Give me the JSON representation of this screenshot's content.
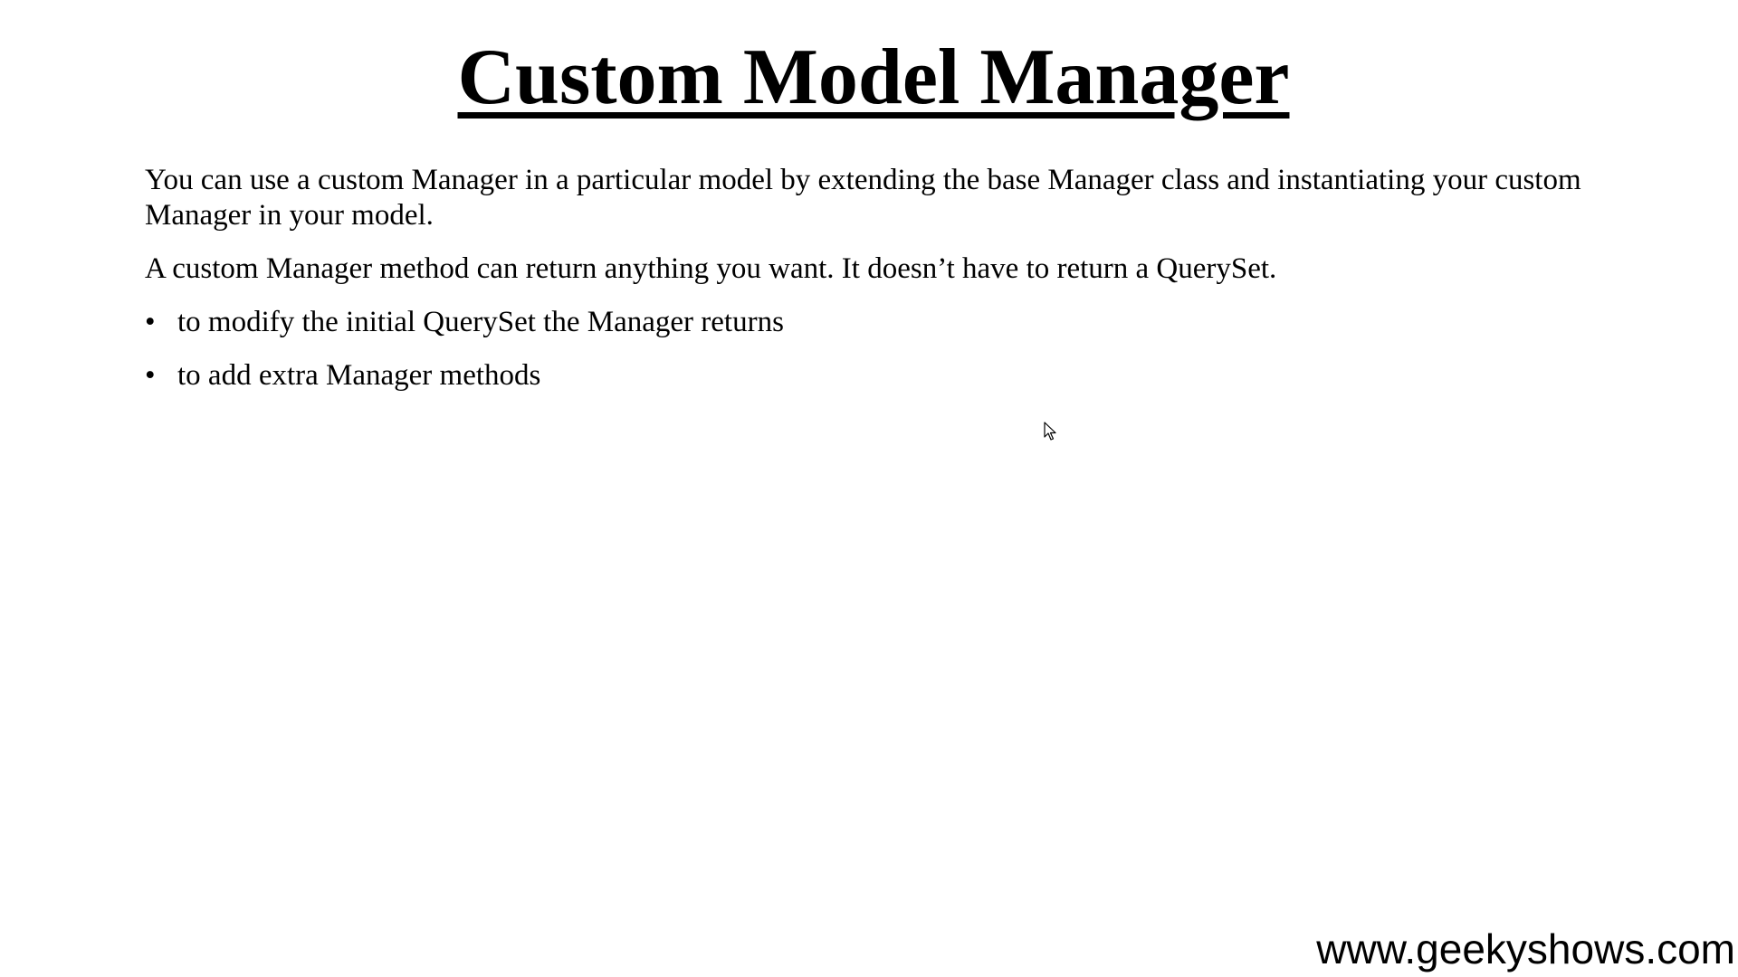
{
  "slide": {
    "title": "Custom Model Manager",
    "paragraphs": [
      "You can use a custom Manager in a particular model by extending the base Manager class and instantiating your custom Manager in your model.",
      "A custom Manager method can return anything you want. It doesn’t have to return a QuerySet."
    ],
    "bullet_symbol": "•",
    "bullets": [
      "to modify the initial QuerySet the Manager returns",
      "to add extra Manager methods"
    ],
    "watermark": "www.geekyshows.com"
  },
  "icons": {
    "cursor": "mouse-pointer-icon"
  }
}
